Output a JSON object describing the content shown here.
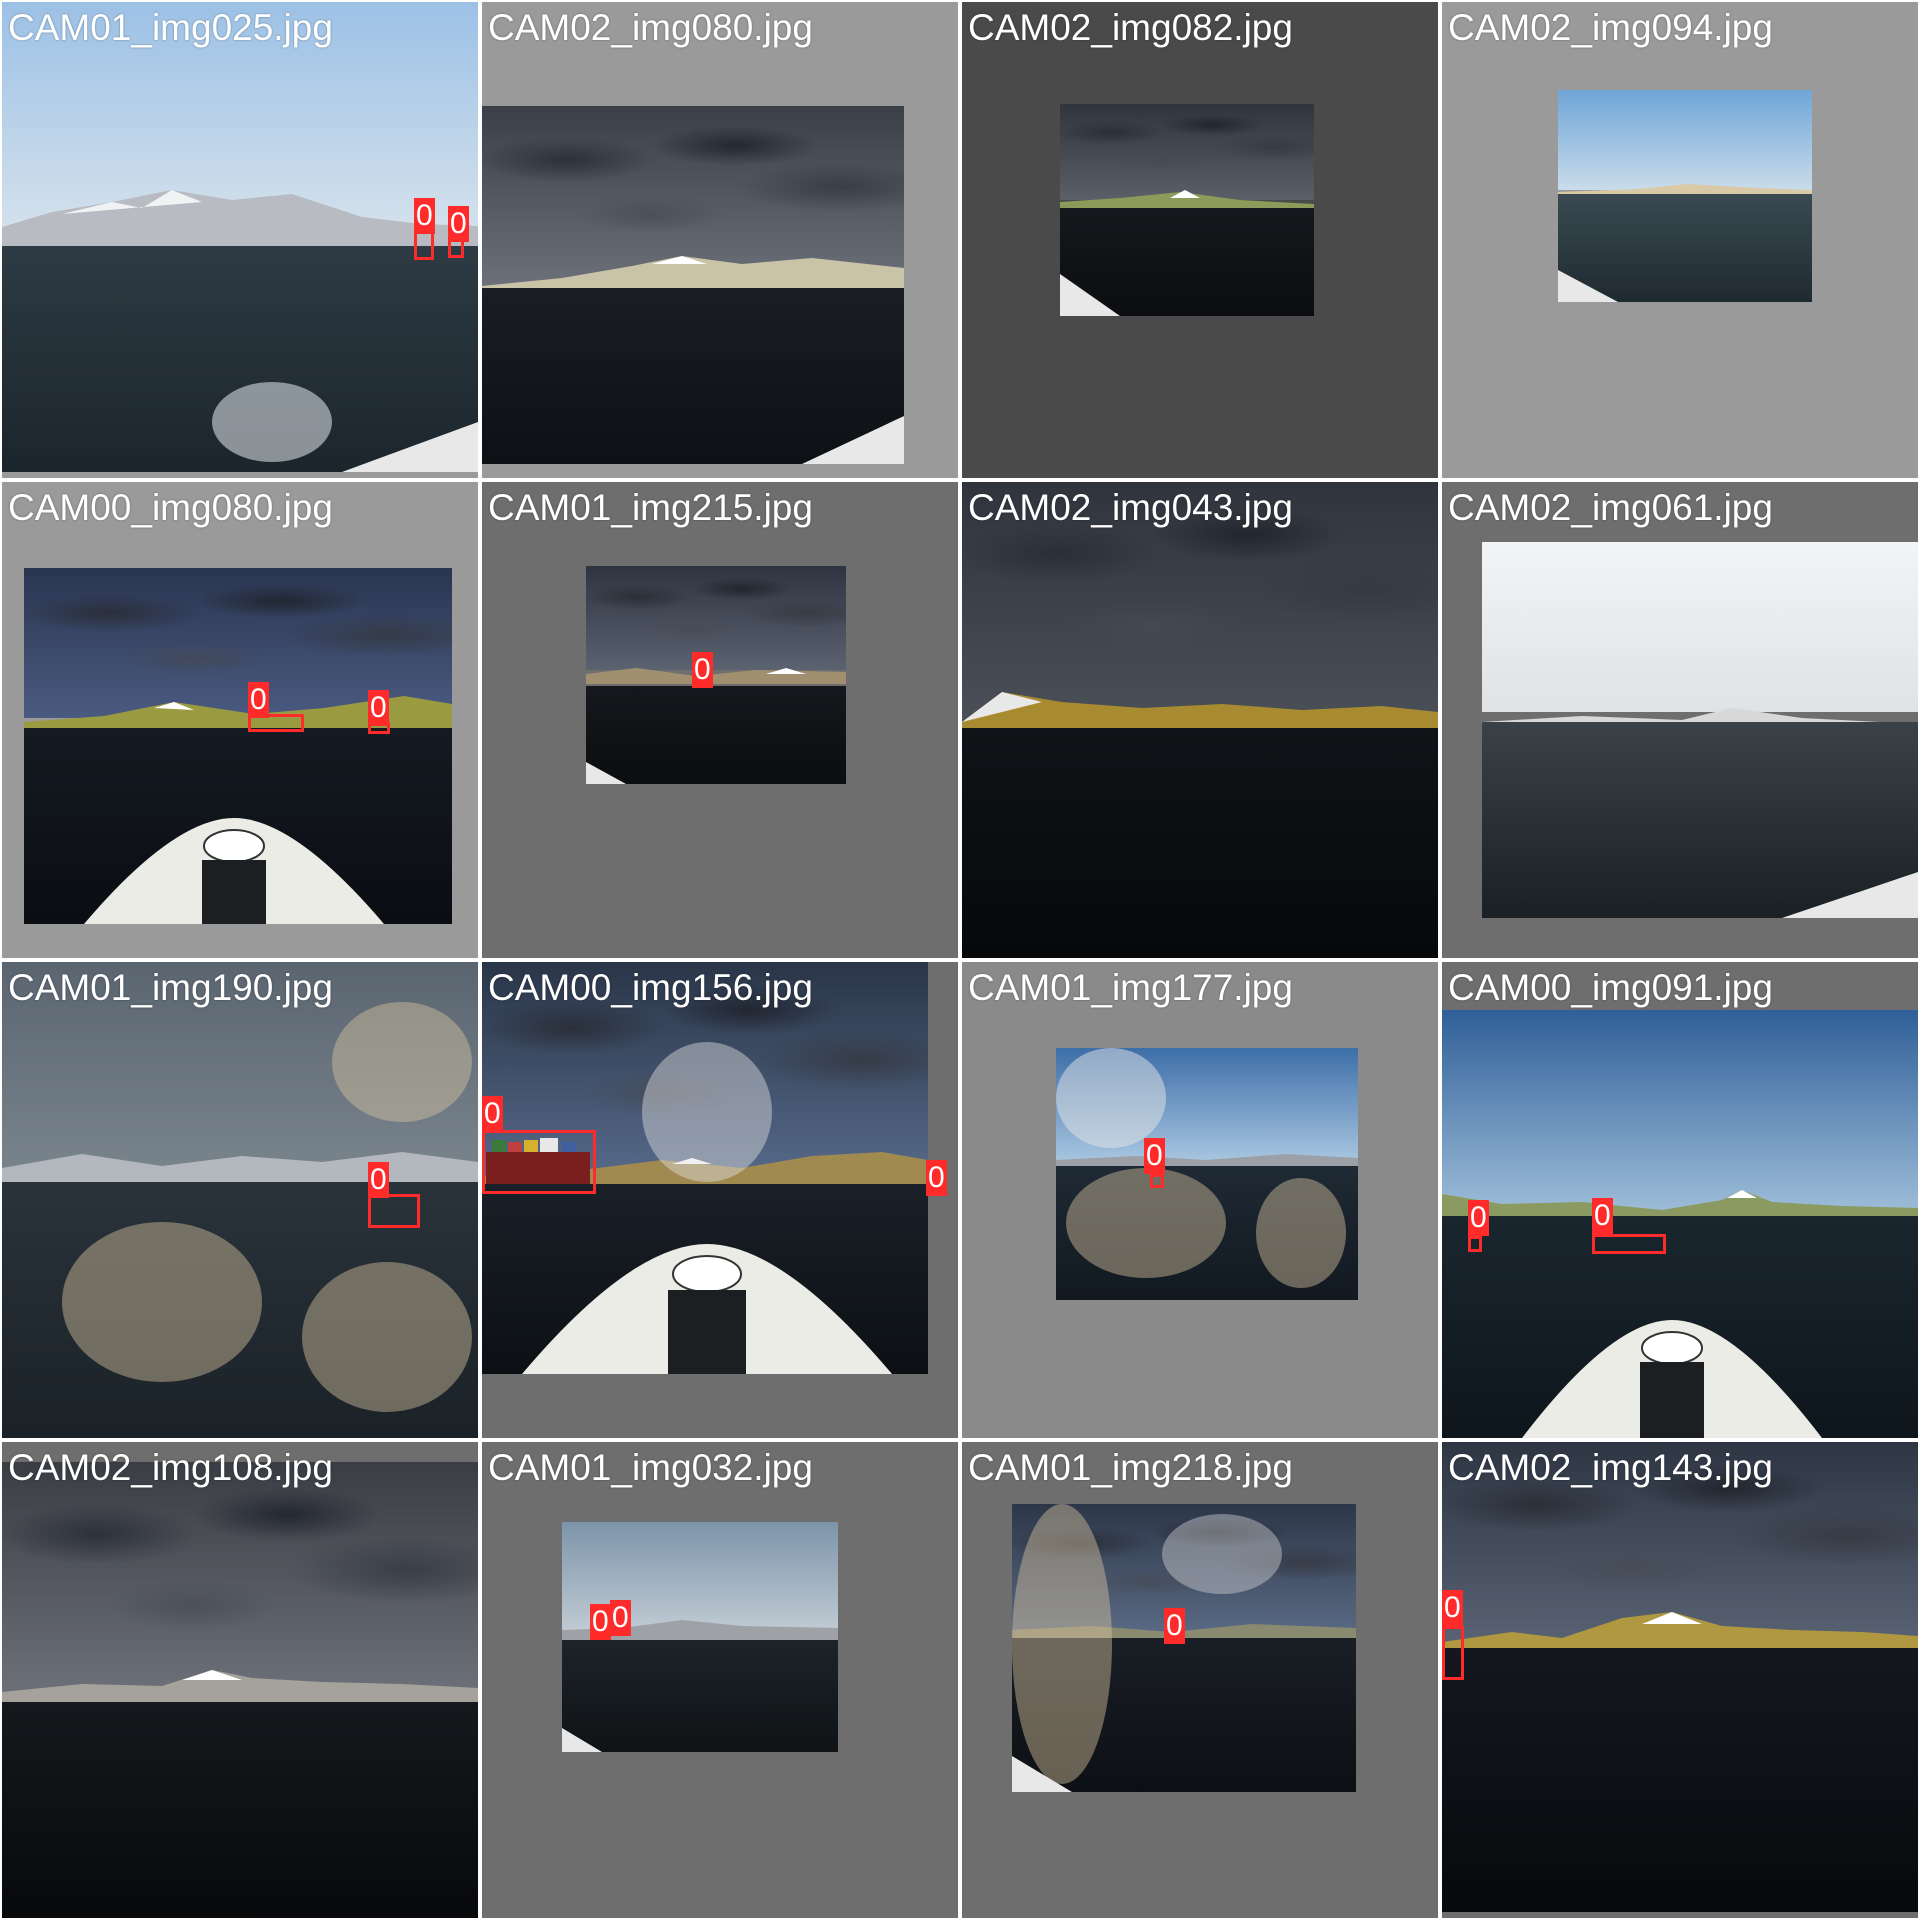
{
  "gallery": {
    "colors": {
      "detection": "#ff2a2a",
      "label_text": "#ffffff"
    },
    "detection_class": "0",
    "tiles": [
      {
        "filename": "CAM01_img025.jpg",
        "padding": "#9a9a9a",
        "detections": 2,
        "variant": "clear-sky-mountains"
      },
      {
        "filename": "CAM02_img080.jpg",
        "padding": "#9a9a9a",
        "detections": 0,
        "variant": "storm-clouds"
      },
      {
        "filename": "CAM02_img082.jpg",
        "padding": "#4a4a4a",
        "detections": 0,
        "variant": "storm-clouds"
      },
      {
        "filename": "CAM02_img094.jpg",
        "padding": "#9a9a9a",
        "detections": 0,
        "variant": "clear-sky"
      },
      {
        "filename": "CAM00_img080.jpg",
        "padding": "#9a9a9a",
        "detections": 2,
        "variant": "storm-with-bow"
      },
      {
        "filename": "CAM01_img215.jpg",
        "padding": "#6e6e6e",
        "detections": 1,
        "variant": "storm-clouds"
      },
      {
        "filename": "CAM02_img043.jpg",
        "padding": "#6e6e6e",
        "detections": 0,
        "variant": "dark-storm-gold"
      },
      {
        "filename": "CAM02_img061.jpg",
        "padding": "#6e6e6e",
        "detections": 0,
        "variant": "bright-haze"
      },
      {
        "filename": "CAM01_img190.jpg",
        "padding": "#6e6e6e",
        "detections": 1,
        "variant": "hazy-smudged"
      },
      {
        "filename": "CAM00_img156.jpg",
        "padding": "#6e6e6e",
        "detections": 2,
        "variant": "storm-ship-bow"
      },
      {
        "filename": "CAM01_img177.jpg",
        "padding": "#8a8a8a",
        "detections": 1,
        "variant": "smudged-blue"
      },
      {
        "filename": "CAM00_img091.jpg",
        "padding": "#6e6e6e",
        "detections": 2,
        "variant": "clear-sky-bow"
      },
      {
        "filename": "CAM02_img108.jpg",
        "padding": "#6e6e6e",
        "detections": 0,
        "variant": "overcast"
      },
      {
        "filename": "CAM01_img032.jpg",
        "padding": "#6e6e6e",
        "detections": 2,
        "variant": "overcast-light"
      },
      {
        "filename": "CAM01_img218.jpg",
        "padding": "#6e6e6e",
        "detections": 1,
        "variant": "storm-smudged"
      },
      {
        "filename": "CAM02_img143.jpg",
        "padding": "#6e6e6e",
        "detections": 1,
        "variant": "storm-gold"
      }
    ]
  }
}
